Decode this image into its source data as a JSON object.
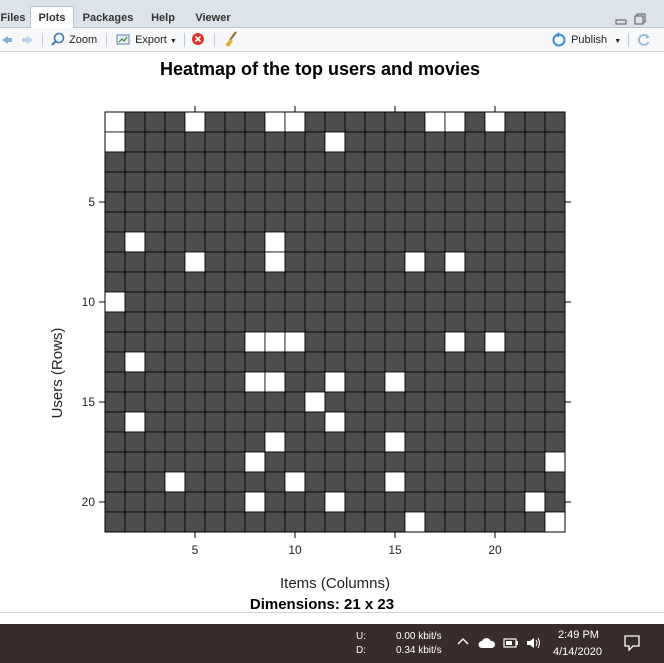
{
  "tabs": [
    {
      "label": "Files",
      "active": false
    },
    {
      "label": "Plots",
      "active": true
    },
    {
      "label": "Packages",
      "active": false
    },
    {
      "label": "Help",
      "active": false
    },
    {
      "label": "Viewer",
      "active": false
    }
  ],
  "toolbar": {
    "zoom_label": "Zoom",
    "export_label": "Export",
    "publish_label": "Publish",
    "icons": [
      "back-arrow-icon",
      "forward-arrow-icon",
      "zoom-magnifier-icon",
      "export-icon",
      "remove-plot-icon",
      "broom-icon",
      "publish-icon",
      "refresh-icon"
    ]
  },
  "chart_data": {
    "type": "heatmap",
    "title": "Heatmap of the top users and movies",
    "xlabel": "Items (Columns)",
    "ylabel": "Users (Rows)",
    "subtitle": "Dimensions: 21 x 23",
    "n_rows": 21,
    "n_cols": 23,
    "x_ticks": [
      5,
      10,
      15,
      20
    ],
    "y_ticks": [
      5,
      10,
      15,
      20
    ],
    "colors": {
      "filled": "#4d4d4d",
      "empty": "#ffffff",
      "grid": "#000000"
    },
    "white_cells": [
      [
        1,
        1
      ],
      [
        1,
        5
      ],
      [
        1,
        9
      ],
      [
        1,
        10
      ],
      [
        1,
        17
      ],
      [
        1,
        18
      ],
      [
        1,
        20
      ],
      [
        2,
        1
      ],
      [
        2,
        12
      ],
      [
        7,
        2
      ],
      [
        7,
        9
      ],
      [
        8,
        5
      ],
      [
        8,
        9
      ],
      [
        8,
        16
      ],
      [
        8,
        18
      ],
      [
        10,
        1
      ],
      [
        12,
        8
      ],
      [
        12,
        9
      ],
      [
        12,
        10
      ],
      [
        12,
        18
      ],
      [
        12,
        20
      ],
      [
        13,
        2
      ],
      [
        14,
        8
      ],
      [
        14,
        9
      ],
      [
        14,
        12
      ],
      [
        14,
        15
      ],
      [
        15,
        11
      ],
      [
        16,
        2
      ],
      [
        16,
        12
      ],
      [
        17,
        9
      ],
      [
        17,
        15
      ],
      [
        18,
        8
      ],
      [
        18,
        23
      ],
      [
        19,
        4
      ],
      [
        19,
        10
      ],
      [
        19,
        15
      ],
      [
        20,
        8
      ],
      [
        20,
        12
      ],
      [
        20,
        22
      ],
      [
        21,
        16
      ],
      [
        21,
        23
      ]
    ]
  },
  "taskbar": {
    "net_upload_label": "U:",
    "net_download_label": "D:",
    "upload_rate": "0.00 kbit/s",
    "download_rate": "0.34 kbit/s",
    "time": "2:49 PM",
    "date": "4/14/2020"
  }
}
